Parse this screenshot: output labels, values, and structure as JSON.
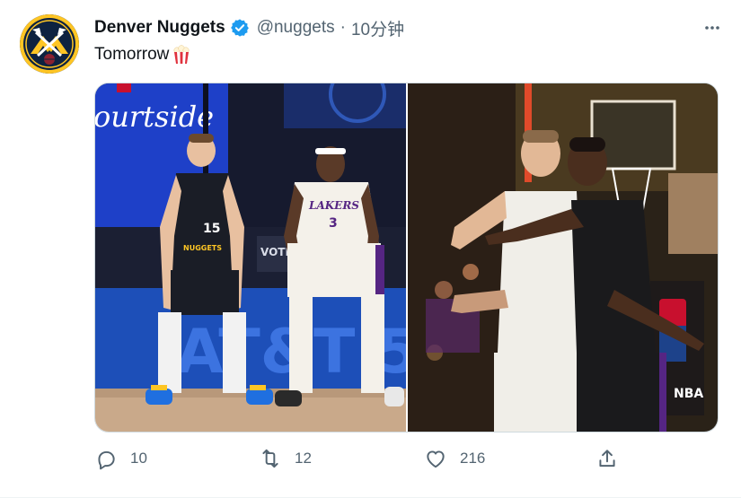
{
  "tweet": {
    "author_name": "Denver Nuggets",
    "author_handle": "@nuggets",
    "separator": "·",
    "timestamp": "10分钟",
    "text": "Tomorrow",
    "emoji": "popcorn-icon"
  },
  "photos": {
    "left": {
      "banner_text": "ourtside",
      "court_text": "AT&T 5",
      "player1_jersey": "15",
      "player1_team": "NUGGETS",
      "player2_jersey": "3",
      "player2_team": "LAKERS",
      "sign_text": "VOTE"
    },
    "right": {
      "sign_text": "NBA"
    }
  },
  "actions": {
    "reply_count": "10",
    "retweet_count": "12",
    "like_count": "216"
  },
  "colors": {
    "verified": "#1d9bf0",
    "secondary_text": "#536471",
    "nuggets_navy": "#0E2240",
    "nuggets_gold": "#FEC524",
    "court_blue": "#1d4fb8",
    "lakers_purple": "#552583",
    "lakers_gold": "#FDB927"
  }
}
